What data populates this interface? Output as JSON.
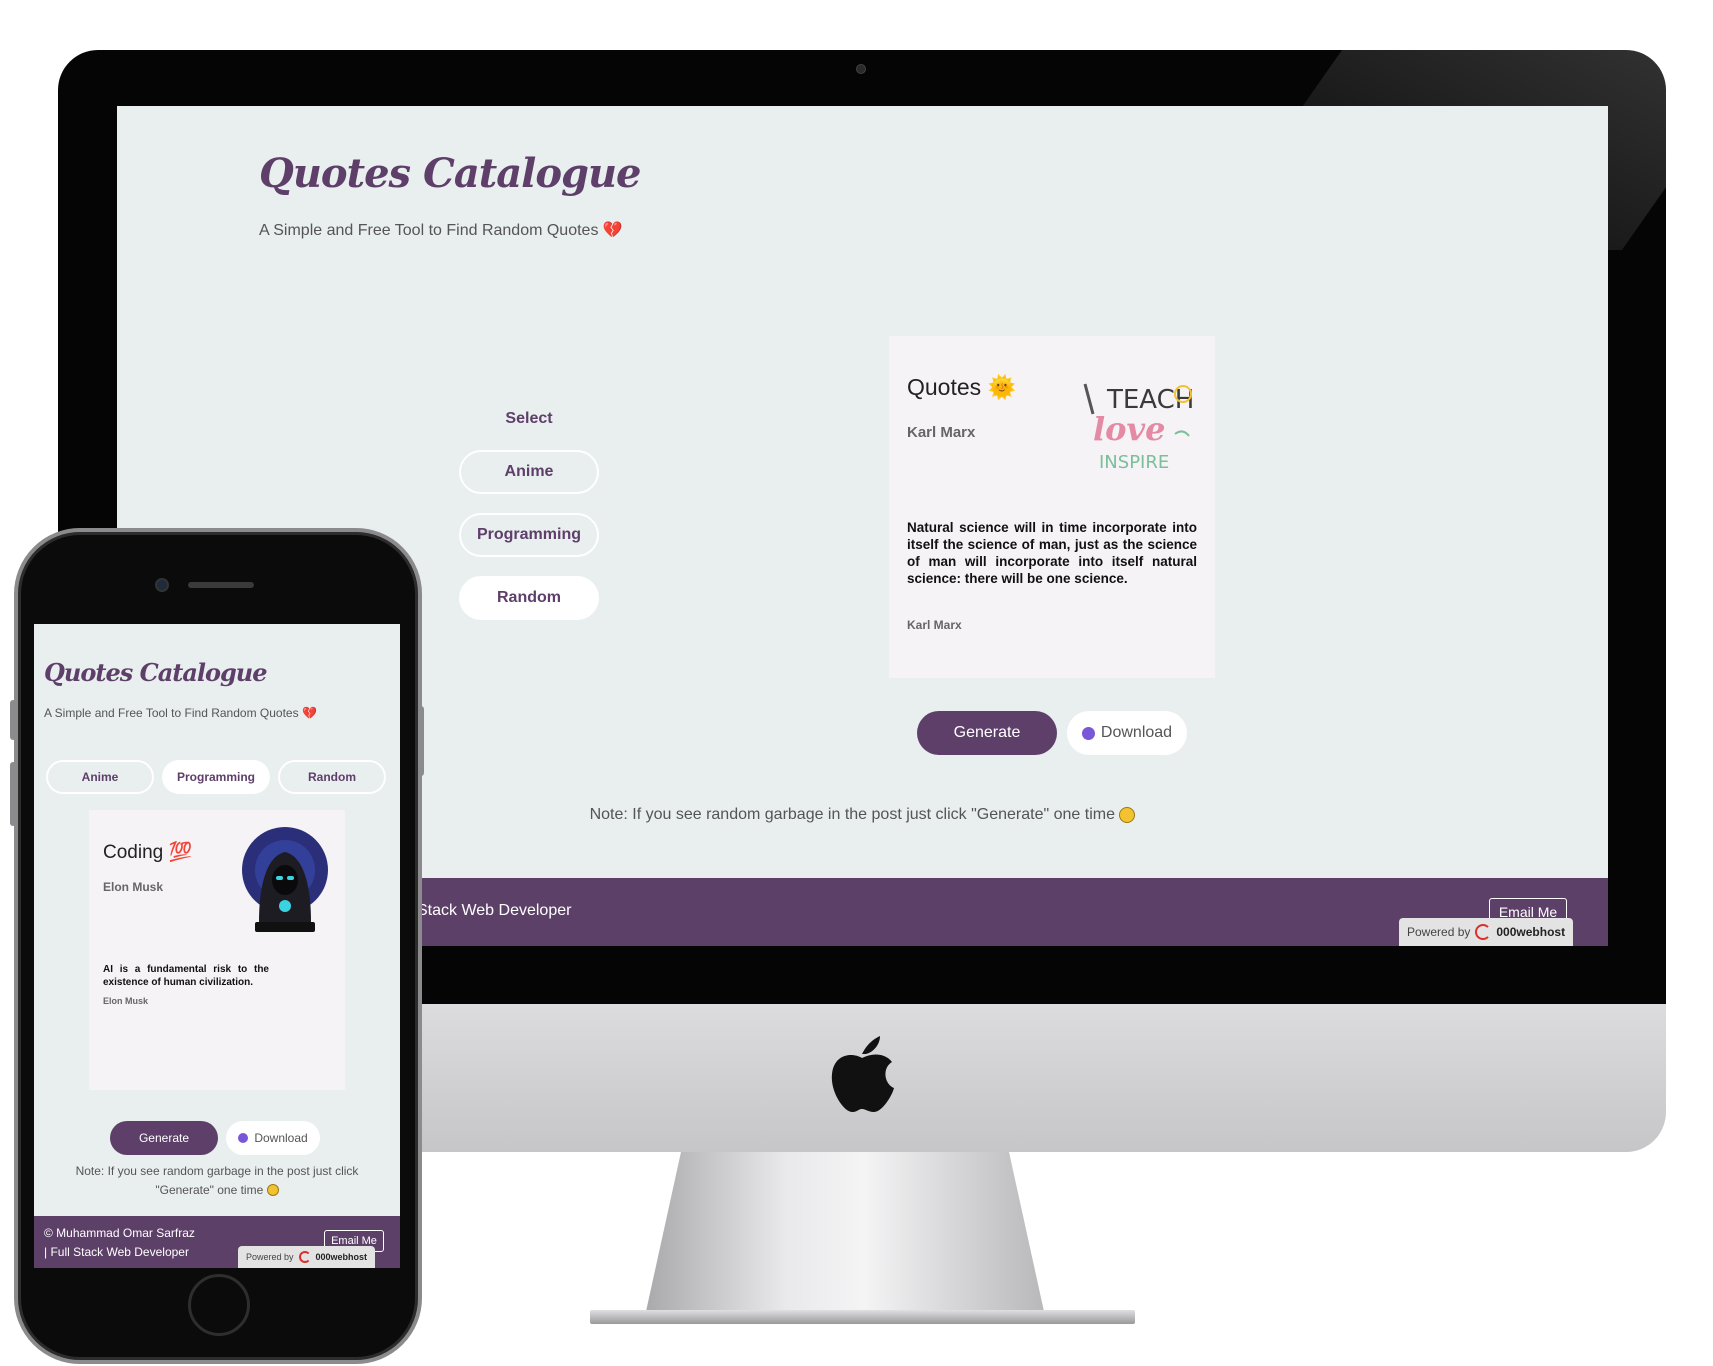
{
  "app": {
    "title": "Quotes Catalogue",
    "subtitle": "A Simple and Free Tool to Find Random Quotes",
    "heart_emoji": "💔"
  },
  "desktop": {
    "select_label": "Select",
    "categories": [
      {
        "label": "Anime",
        "active": false
      },
      {
        "label": "Programming",
        "active": false
      },
      {
        "label": "Random",
        "active": true
      }
    ],
    "card": {
      "heading": "Quotes",
      "heading_emoji": "🌞",
      "author": "Karl  Marx",
      "image_text": [
        "TEACH",
        "love",
        "INSPIRE"
      ],
      "quote": "Natural science will in time incorporate into itself the science of man, just as the science of man will incorporate into itself natural science: there will be one science.",
      "cite": "Karl  Marx"
    },
    "generate_label": "Generate",
    "download_label": "Download",
    "note": "Note: If you see random garbage in the post just click \"Generate\" one time",
    "footer_text": "Stack Web Developer",
    "email_label": "Email Me",
    "powered_prefix": "Powered by",
    "powered_brand": "000webhost"
  },
  "mobile": {
    "categories": [
      {
        "label": "Anime",
        "active": false
      },
      {
        "label": "Programming",
        "active": true
      },
      {
        "label": "Random",
        "active": false
      }
    ],
    "card": {
      "heading": "Coding",
      "heading_emoji": "💯",
      "author": "Elon  Musk",
      "quote": "AI is a fundamental risk to the existence of human civilization.",
      "cite": "Elon  Musk"
    },
    "generate_label": "Generate",
    "download_label": "Download",
    "note_line1": "Note: If you see random garbage in the post just click",
    "note_line2": "\"Generate\" one time",
    "footer_line1": "© Muhammad Omar Sarfraz",
    "footer_line2": "| Full Stack Web Developer",
    "email_label": "Email Me",
    "powered_prefix": "Powered by",
    "powered_brand": "000webhost"
  },
  "colors": {
    "brand": "#5d3f6a",
    "page_bg": "#e9eeee",
    "card_bg": "#f5f3f6",
    "footer_bg": "#5d4068"
  }
}
